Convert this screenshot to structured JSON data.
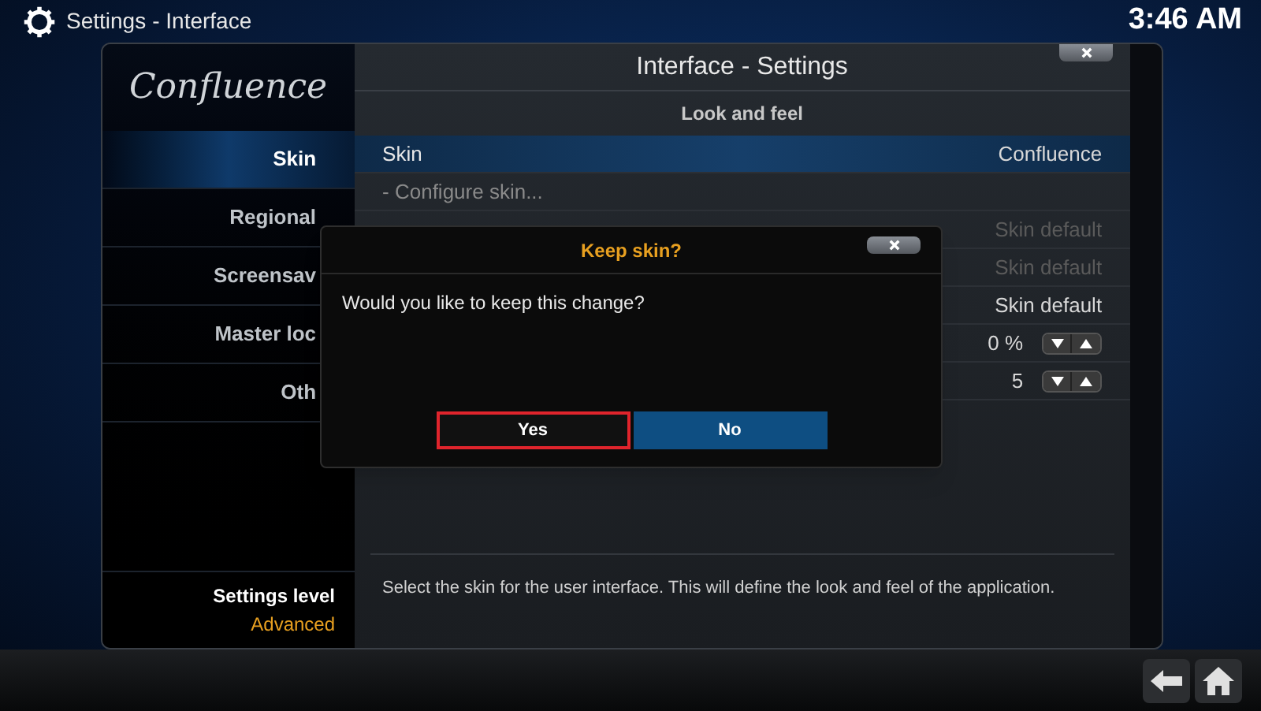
{
  "header": {
    "title": "Settings",
    "subtitle": "- Interface",
    "time": "3:46 AM"
  },
  "window": {
    "title": "Interface - Settings",
    "logo": "Confluence"
  },
  "sidebar": {
    "items": [
      {
        "label": "Skin",
        "selected": true
      },
      {
        "label": "Regional",
        "selected": false
      },
      {
        "label": "Screensav",
        "selected": false
      },
      {
        "label": "Master loc",
        "selected": false
      },
      {
        "label": "Oth",
        "selected": false
      }
    ],
    "settings_level": {
      "label": "Settings level",
      "value": "Advanced"
    }
  },
  "section": "Look and feel",
  "settings": [
    {
      "kind": "value",
      "label": "Skin",
      "value": "Confluence"
    },
    {
      "kind": "action",
      "label": "- Configure skin..."
    },
    {
      "kind": "value",
      "value": "Skin default",
      "disabled": true
    },
    {
      "kind": "value",
      "value": "Skin default",
      "disabled": true
    },
    {
      "kind": "value",
      "value": "Skin default",
      "disabled": false
    },
    {
      "kind": "spinner",
      "value": "0 %"
    },
    {
      "kind": "spinner",
      "value": "5"
    }
  ],
  "description": "Select the skin for the user interface. This will define the look and feel of the application.",
  "dialog": {
    "title": "Keep skin?",
    "message": "Would you like to keep this change?",
    "buttons": [
      {
        "label": "Yes",
        "selected": false,
        "outlined": true
      },
      {
        "label": "No",
        "selected": true,
        "outlined": false
      }
    ]
  }
}
